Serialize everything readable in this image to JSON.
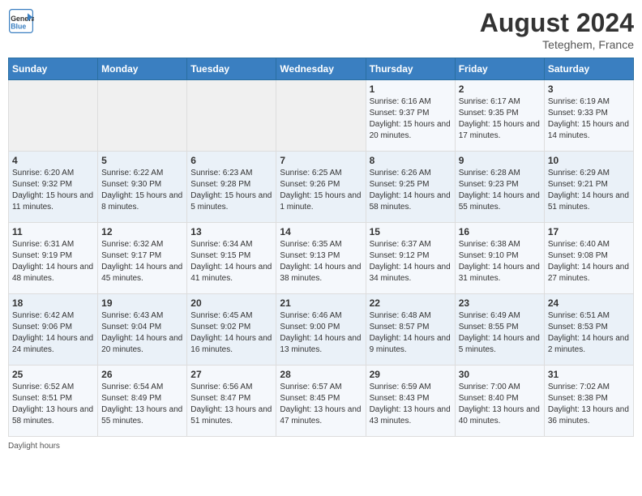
{
  "logo": {
    "line1": "General",
    "line2": "Blue"
  },
  "title": "August 2024",
  "location": "Teteghem, France",
  "days_of_week": [
    "Sunday",
    "Monday",
    "Tuesday",
    "Wednesday",
    "Thursday",
    "Friday",
    "Saturday"
  ],
  "weeks": [
    [
      {
        "day": "",
        "sunrise": "",
        "sunset": "",
        "daylight": ""
      },
      {
        "day": "",
        "sunrise": "",
        "sunset": "",
        "daylight": ""
      },
      {
        "day": "",
        "sunrise": "",
        "sunset": "",
        "daylight": ""
      },
      {
        "day": "",
        "sunrise": "",
        "sunset": "",
        "daylight": ""
      },
      {
        "day": "1",
        "sunrise": "Sunrise: 6:16 AM",
        "sunset": "Sunset: 9:37 PM",
        "daylight": "Daylight: 15 hours and 20 minutes."
      },
      {
        "day": "2",
        "sunrise": "Sunrise: 6:17 AM",
        "sunset": "Sunset: 9:35 PM",
        "daylight": "Daylight: 15 hours and 17 minutes."
      },
      {
        "day": "3",
        "sunrise": "Sunrise: 6:19 AM",
        "sunset": "Sunset: 9:33 PM",
        "daylight": "Daylight: 15 hours and 14 minutes."
      }
    ],
    [
      {
        "day": "4",
        "sunrise": "Sunrise: 6:20 AM",
        "sunset": "Sunset: 9:32 PM",
        "daylight": "Daylight: 15 hours and 11 minutes."
      },
      {
        "day": "5",
        "sunrise": "Sunrise: 6:22 AM",
        "sunset": "Sunset: 9:30 PM",
        "daylight": "Daylight: 15 hours and 8 minutes."
      },
      {
        "day": "6",
        "sunrise": "Sunrise: 6:23 AM",
        "sunset": "Sunset: 9:28 PM",
        "daylight": "Daylight: 15 hours and 5 minutes."
      },
      {
        "day": "7",
        "sunrise": "Sunrise: 6:25 AM",
        "sunset": "Sunset: 9:26 PM",
        "daylight": "Daylight: 15 hours and 1 minute."
      },
      {
        "day": "8",
        "sunrise": "Sunrise: 6:26 AM",
        "sunset": "Sunset: 9:25 PM",
        "daylight": "Daylight: 14 hours and 58 minutes."
      },
      {
        "day": "9",
        "sunrise": "Sunrise: 6:28 AM",
        "sunset": "Sunset: 9:23 PM",
        "daylight": "Daylight: 14 hours and 55 minutes."
      },
      {
        "day": "10",
        "sunrise": "Sunrise: 6:29 AM",
        "sunset": "Sunset: 9:21 PM",
        "daylight": "Daylight: 14 hours and 51 minutes."
      }
    ],
    [
      {
        "day": "11",
        "sunrise": "Sunrise: 6:31 AM",
        "sunset": "Sunset: 9:19 PM",
        "daylight": "Daylight: 14 hours and 48 minutes."
      },
      {
        "day": "12",
        "sunrise": "Sunrise: 6:32 AM",
        "sunset": "Sunset: 9:17 PM",
        "daylight": "Daylight: 14 hours and 45 minutes."
      },
      {
        "day": "13",
        "sunrise": "Sunrise: 6:34 AM",
        "sunset": "Sunset: 9:15 PM",
        "daylight": "Daylight: 14 hours and 41 minutes."
      },
      {
        "day": "14",
        "sunrise": "Sunrise: 6:35 AM",
        "sunset": "Sunset: 9:13 PM",
        "daylight": "Daylight: 14 hours and 38 minutes."
      },
      {
        "day": "15",
        "sunrise": "Sunrise: 6:37 AM",
        "sunset": "Sunset: 9:12 PM",
        "daylight": "Daylight: 14 hours and 34 minutes."
      },
      {
        "day": "16",
        "sunrise": "Sunrise: 6:38 AM",
        "sunset": "Sunset: 9:10 PM",
        "daylight": "Daylight: 14 hours and 31 minutes."
      },
      {
        "day": "17",
        "sunrise": "Sunrise: 6:40 AM",
        "sunset": "Sunset: 9:08 PM",
        "daylight": "Daylight: 14 hours and 27 minutes."
      }
    ],
    [
      {
        "day": "18",
        "sunrise": "Sunrise: 6:42 AM",
        "sunset": "Sunset: 9:06 PM",
        "daylight": "Daylight: 14 hours and 24 minutes."
      },
      {
        "day": "19",
        "sunrise": "Sunrise: 6:43 AM",
        "sunset": "Sunset: 9:04 PM",
        "daylight": "Daylight: 14 hours and 20 minutes."
      },
      {
        "day": "20",
        "sunrise": "Sunrise: 6:45 AM",
        "sunset": "Sunset: 9:02 PM",
        "daylight": "Daylight: 14 hours and 16 minutes."
      },
      {
        "day": "21",
        "sunrise": "Sunrise: 6:46 AM",
        "sunset": "Sunset: 9:00 PM",
        "daylight": "Daylight: 14 hours and 13 minutes."
      },
      {
        "day": "22",
        "sunrise": "Sunrise: 6:48 AM",
        "sunset": "Sunset: 8:57 PM",
        "daylight": "Daylight: 14 hours and 9 minutes."
      },
      {
        "day": "23",
        "sunrise": "Sunrise: 6:49 AM",
        "sunset": "Sunset: 8:55 PM",
        "daylight": "Daylight: 14 hours and 5 minutes."
      },
      {
        "day": "24",
        "sunrise": "Sunrise: 6:51 AM",
        "sunset": "Sunset: 8:53 PM",
        "daylight": "Daylight: 14 hours and 2 minutes."
      }
    ],
    [
      {
        "day": "25",
        "sunrise": "Sunrise: 6:52 AM",
        "sunset": "Sunset: 8:51 PM",
        "daylight": "Daylight: 13 hours and 58 minutes."
      },
      {
        "day": "26",
        "sunrise": "Sunrise: 6:54 AM",
        "sunset": "Sunset: 8:49 PM",
        "daylight": "Daylight: 13 hours and 55 minutes."
      },
      {
        "day": "27",
        "sunrise": "Sunrise: 6:56 AM",
        "sunset": "Sunset: 8:47 PM",
        "daylight": "Daylight: 13 hours and 51 minutes."
      },
      {
        "day": "28",
        "sunrise": "Sunrise: 6:57 AM",
        "sunset": "Sunset: 8:45 PM",
        "daylight": "Daylight: 13 hours and 47 minutes."
      },
      {
        "day": "29",
        "sunrise": "Sunrise: 6:59 AM",
        "sunset": "Sunset: 8:43 PM",
        "daylight": "Daylight: 13 hours and 43 minutes."
      },
      {
        "day": "30",
        "sunrise": "Sunrise: 7:00 AM",
        "sunset": "Sunset: 8:40 PM",
        "daylight": "Daylight: 13 hours and 40 minutes."
      },
      {
        "day": "31",
        "sunrise": "Sunrise: 7:02 AM",
        "sunset": "Sunset: 8:38 PM",
        "daylight": "Daylight: 13 hours and 36 minutes."
      }
    ]
  ],
  "footer": {
    "daylight_label": "Daylight hours"
  }
}
